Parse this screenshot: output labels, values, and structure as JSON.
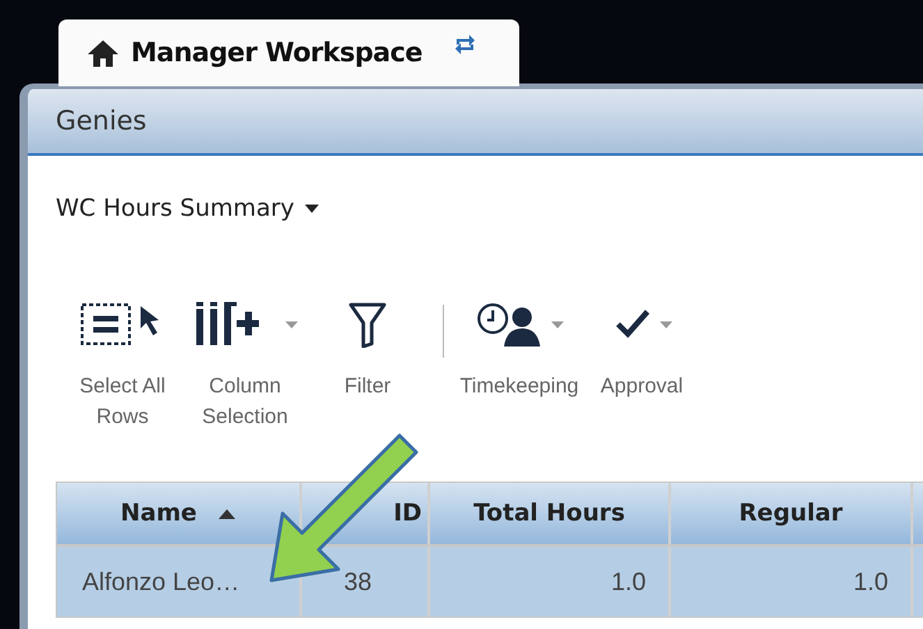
{
  "tab": {
    "title": "Manager Workspace",
    "selected": true
  },
  "panel": {
    "title": "Genies"
  },
  "view_selector": {
    "label": "WC Hours Summary"
  },
  "toolbar": [
    {
      "kind": "select-all",
      "label": "Select All Rows",
      "dropdown": false
    },
    {
      "kind": "columns",
      "label": "Column Selection",
      "dropdown": true
    },
    {
      "kind": "filter",
      "label": "Filter",
      "dropdown": false
    },
    {
      "kind": "timekeeping",
      "label": "Timekeeping",
      "dropdown": true
    },
    {
      "kind": "approval",
      "label": "Approval",
      "dropdown": true
    }
  ],
  "table": {
    "columns": [
      {
        "label": "Name",
        "sorted": true
      },
      {
        "label": "ID",
        "sorted": false
      },
      {
        "label": "Total Hours",
        "sorted": false
      },
      {
        "label": "Regular",
        "sorted": false
      }
    ],
    "rows": [
      {
        "selected": true,
        "cells": [
          "Alfonzo Leo…",
          "38",
          "1.0",
          "1.0"
        ]
      }
    ]
  }
}
